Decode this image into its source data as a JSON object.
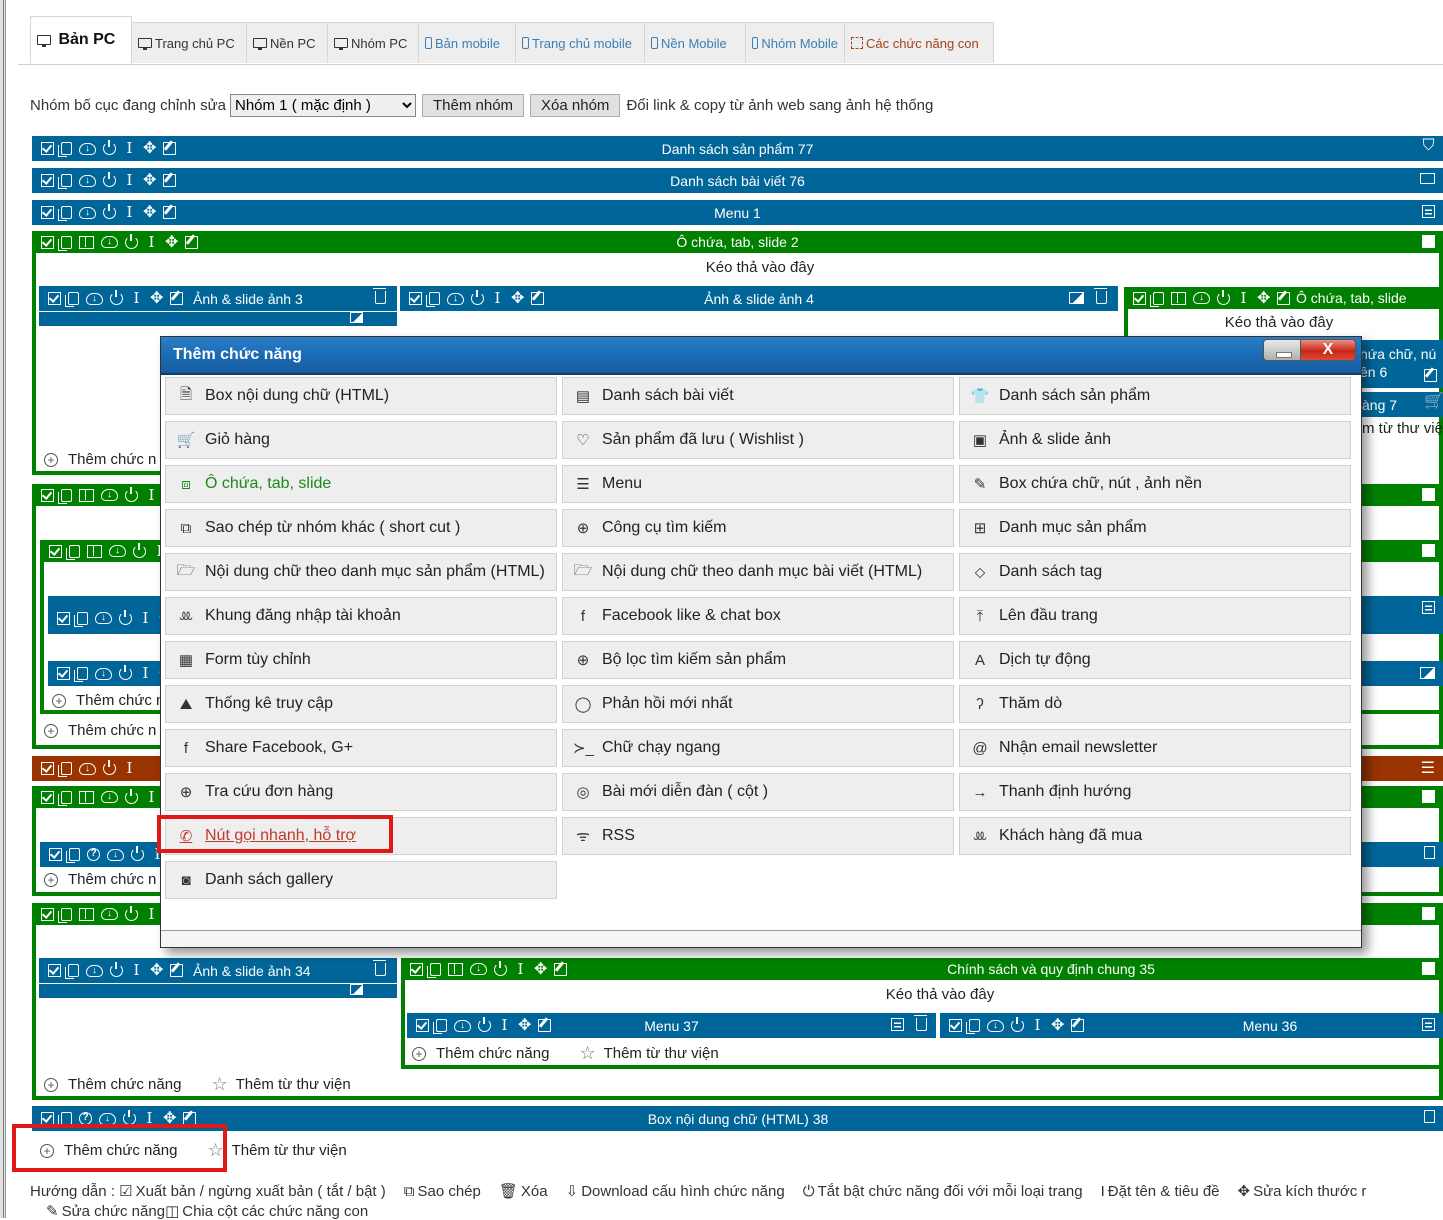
{
  "tabs": [
    {
      "label": "Bản PC",
      "icon": "monitor-icon",
      "active": true
    },
    {
      "label": "Trang chủ PC",
      "icon": "monitor-icon"
    },
    {
      "label": "Nền PC",
      "icon": "monitor-icon"
    },
    {
      "label": "Nhóm PC",
      "icon": "monitor-icon"
    },
    {
      "label": "Bản mobile",
      "icon": "phone-icon"
    },
    {
      "label": "Trang chủ mobile",
      "icon": "phone-icon"
    },
    {
      "label": "Nền Mobile",
      "icon": "phone-icon"
    },
    {
      "label": "Nhóm Mobile",
      "icon": "phone-icon"
    },
    {
      "label": "Các chức năng con",
      "icon": "subfunction-icon"
    }
  ],
  "toolbar": {
    "group_label": "Nhóm bố cục đang chỉnh sửa",
    "group_selected": "Nhóm 1 ( mặc định )",
    "add_group": "Thêm nhóm",
    "delete_group": "Xóa nhóm",
    "link_text": "Đổi link & copy từ ảnh web sang ảnh hệ thống"
  },
  "bars": {
    "products": "Danh sách sản phẩm 77",
    "posts": "Danh sách bài viết 76",
    "menu1": "Menu 1",
    "container2": "Ô chứa, tab, slide 2",
    "slide3": "Ảnh & slide ảnh 3",
    "slide4": "Ảnh & slide ảnh 4",
    "container_right": "Ô chứa, tab, slide",
    "box6_a": "hứa chữ, nú",
    "box6_b": "ền 6",
    "cart7": "àng 7",
    "lib_partial": "m từ thư việ",
    "slide34": "Ảnh & slide ảnh 34",
    "policy35": "Chính sách và quy định chung 35",
    "menu37": "Menu 37",
    "menu36": "Menu 36",
    "html38": "Box nội dung chữ (HTML) 38"
  },
  "dropzone": "Kéo thả vào đây",
  "add_function": "Thêm chức năng",
  "add_function_partial": "Thêm chức n",
  "add_from_library": "Thêm từ thư viện",
  "modal": {
    "title": "Thêm chức năng",
    "close_label": "X",
    "items": [
      [
        "Box nội dung chữ (HTML)",
        "Danh sách bài viết",
        "Danh sách sản phẩm"
      ],
      [
        "Giỏ hàng",
        "Sản phẩm đã lưu ( Wishlist )",
        "Ảnh & slide ảnh"
      ],
      [
        "Ô chứa, tab, slide",
        "Menu",
        "Box chứa chữ, nút , ảnh nền"
      ],
      [
        "Sao chép từ nhóm khác ( short cut )",
        "Công cụ tìm kiếm",
        "Danh mục sản phẩm"
      ],
      [
        "Nội dung chữ theo danh mục sản phẩm (HTML)",
        "Nội dung chữ theo danh mục bài viết (HTML)",
        "Danh sách tag"
      ],
      [
        "Khung đăng nhập tài khoản",
        "Facebook like & chat box",
        "Lên đầu trang"
      ],
      [
        "Form tùy chỉnh",
        "Bộ lọc tìm kiếm sản phẩm",
        "Dịch tự động"
      ],
      [
        "Thống kê truy cập",
        "Phản hồi mới nhất",
        "Thăm dò"
      ],
      [
        "Share Facebook, G+",
        "Chữ chạy ngang",
        "Nhận email newsletter"
      ],
      [
        "Tra cứu đơn hàng",
        "Bài mới diễn đàn ( cột )",
        "Thanh định hướng"
      ],
      [
        "Nút gọi nhanh, hỗ trợ",
        "RSS",
        "Khách hàng đã mua"
      ],
      [
        "Danh sách gallery"
      ]
    ],
    "icons": [
      [
        "document-icon",
        "newspaper-icon",
        "shirt-icon"
      ],
      [
        "cart-icon",
        "heart-icon",
        "image-icon"
      ],
      [
        "container-icon",
        "list-icon",
        "edit-icon"
      ],
      [
        "copy-icon",
        "zoom-in-icon",
        "sitemap-icon"
      ],
      [
        "folder-open-icon",
        "folder-open-icon",
        "tags-icon"
      ],
      [
        "users-icon",
        "facebook-icon",
        "arrow-up-icon"
      ],
      [
        "form-icon",
        "zoom-in-icon",
        "translate-icon"
      ],
      [
        "chart-area-icon",
        "comment-icon",
        "question-icon"
      ],
      [
        "facebook-icon",
        "terminal-icon",
        "at-icon"
      ],
      [
        "zoom-in-icon",
        "comments-icon",
        "arrow-right-icon"
      ],
      [
        "phone-icon",
        "rss-icon",
        "users-icon"
      ],
      [
        "camera-icon"
      ]
    ],
    "glyphs": [
      [
        "🗎",
        "▤",
        "👕"
      ],
      [
        "🛒",
        "♡",
        "▣"
      ],
      [
        "⧈",
        "☰",
        "✎"
      ],
      [
        "⧉",
        "⊕",
        "⊞"
      ],
      [
        "🗁",
        "🗁",
        "⬦"
      ],
      [
        "ꔛ",
        "f",
        "⤒"
      ],
      [
        "▦",
        "⊕",
        "A"
      ],
      [
        "⛰",
        "◯",
        "ʔ"
      ],
      [
        "f",
        "≻_",
        "@"
      ],
      [
        "⊕",
        "◎",
        "→"
      ],
      [
        "✆",
        "ᯤ",
        "ꔛ"
      ],
      [
        "◙"
      ]
    ]
  },
  "hint": {
    "prefix": "Hướng dẫn :",
    "items": [
      {
        "icon": "checkbox-icon",
        "label": "Xuất bản / ngừng xuất bản ( tắt / bật )"
      },
      {
        "icon": "copy-icon",
        "label": "Sao chép"
      },
      {
        "icon": "trash-icon",
        "label": "Xóa"
      },
      {
        "icon": "cloud-download-icon",
        "label": "Download cấu hình chức năng"
      },
      {
        "icon": "power-icon",
        "label": "Tắt bật chức năng đối với mỗi loại trang"
      },
      {
        "icon": "text-cursor-icon",
        "label": "Đặt tên & tiêu đề"
      },
      {
        "icon": "move-icon",
        "label": "Sửa kích thước r"
      }
    ],
    "items2": [
      {
        "icon": "edit-icon",
        "label": "Sửa chức năng"
      },
      {
        "icon": "columns-icon",
        "label": "Chia cột các chức năng con"
      }
    ]
  },
  "colors": {
    "blue_bar": "#006699",
    "green_bar": "#008000",
    "brown_bar": "#993300",
    "highlight": "#e01818"
  }
}
